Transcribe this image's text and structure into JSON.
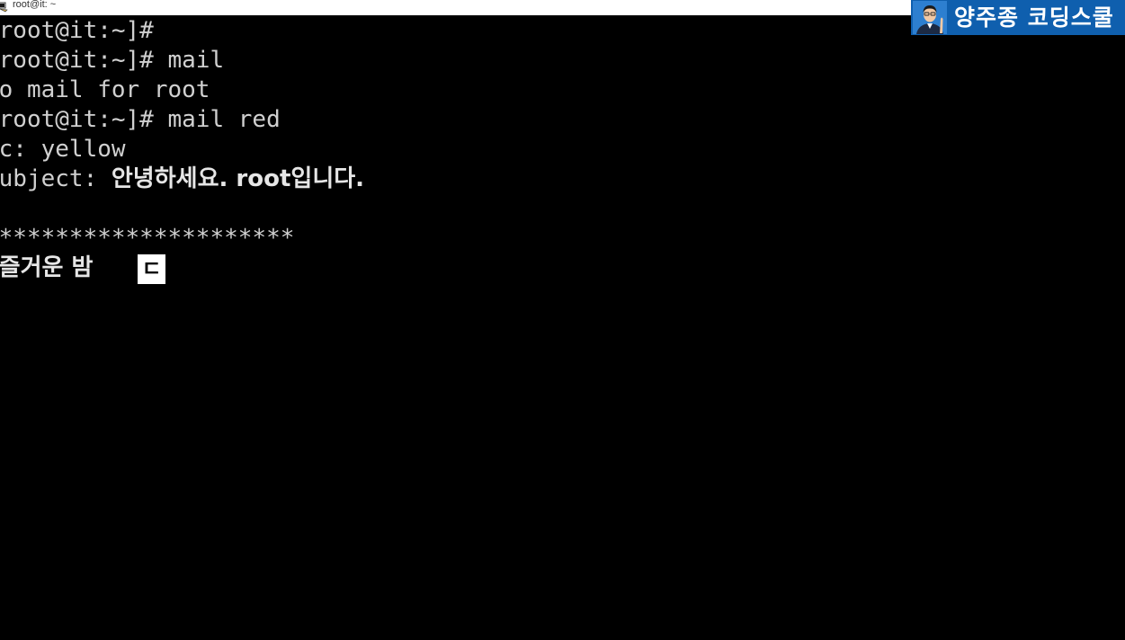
{
  "window": {
    "title": "root@it: ~"
  },
  "logo": {
    "text": "양주종 코딩스쿨"
  },
  "terminal": {
    "lines": [
      {
        "prefix": "[root@it:~]#",
        "korean": ""
      },
      {
        "prefix": "[root@it:~]# mail",
        "korean": ""
      },
      {
        "prefix": "No mail for root",
        "korean": ""
      },
      {
        "prefix": "[root@it:~]# mail red",
        "korean": ""
      },
      {
        "prefix": "Cc: yellow",
        "korean": ""
      },
      {
        "prefix": "Subject: ",
        "korean": "안녕하세요. root입니다."
      },
      {
        "prefix": "",
        "korean": ""
      },
      {
        "prefix": " *********************",
        "korean": ""
      },
      {
        "prefix": " ",
        "korean": "즐거운 밤"
      }
    ],
    "cursor_char": "ㄷ"
  },
  "colors": {
    "background": "#000000",
    "text": "#d0d0d0",
    "logo_bg": "#0f5fae"
  },
  "icons": {
    "app": "putty-icon"
  }
}
